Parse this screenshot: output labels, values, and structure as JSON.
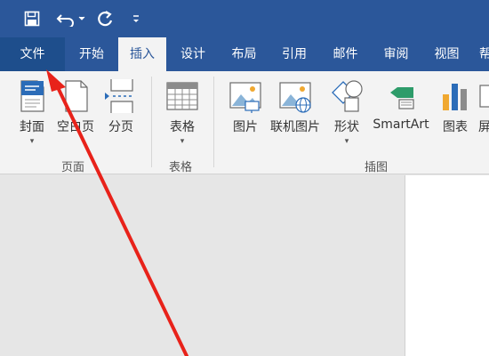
{
  "quick_access": {
    "icons": [
      "save-icon",
      "undo-icon",
      "redo-icon",
      "customize-qat-icon"
    ]
  },
  "tabs": [
    {
      "label": "文件"
    },
    {
      "label": "开始"
    },
    {
      "label": "插入"
    },
    {
      "label": "设计"
    },
    {
      "label": "布局"
    },
    {
      "label": "引用"
    },
    {
      "label": "邮件"
    },
    {
      "label": "审阅"
    },
    {
      "label": "视图"
    },
    {
      "label": "帮"
    }
  ],
  "ribbon": {
    "pages_group": {
      "label": "页面",
      "buttons": [
        {
          "label": "封面",
          "icon": "cover-page-icon",
          "dropdown": true
        },
        {
          "label": "空白页",
          "icon": "blank-page-icon"
        },
        {
          "label": "分页",
          "icon": "page-break-icon"
        }
      ]
    },
    "tables_group": {
      "label": "表格",
      "buttons": [
        {
          "label": "表格",
          "icon": "table-icon",
          "dropdown": true
        }
      ]
    },
    "illustrations_group": {
      "label": "插图",
      "buttons": [
        {
          "label": "图片",
          "icon": "picture-icon"
        },
        {
          "label": "联机图片",
          "icon": "online-picture-icon"
        },
        {
          "label": "形状",
          "icon": "shapes-icon",
          "dropdown": true
        },
        {
          "label": "SmartArt",
          "icon": "smartart-icon"
        },
        {
          "label": "图表",
          "icon": "chart-icon"
        },
        {
          "label": "屏",
          "icon": "screenshot-icon"
        }
      ]
    }
  },
  "colors": {
    "title_bar": "#2b579a",
    "file_tab": "#1e4e8c",
    "ribbon_bg": "#f3f3f3",
    "annotation_arrow": "#e8221a"
  }
}
